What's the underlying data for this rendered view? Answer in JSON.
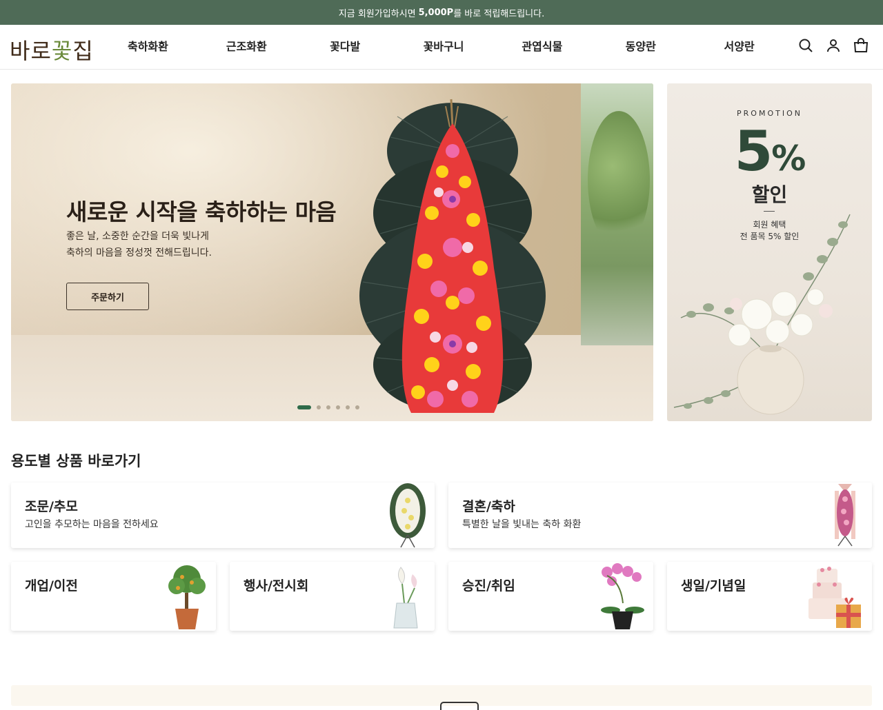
{
  "top_banner": {
    "text_prefix": "지금 회원가입하시면",
    "text_bold": "5,000P",
    "text_suffix": "를 바로 적립해드립니다."
  },
  "header": {
    "logo": {
      "part1": "바로",
      "part2": "꽃",
      "part3": "집"
    },
    "nav": [
      "축하화환",
      "근조화환",
      "꽃다발",
      "꽃바구니",
      "관엽식물",
      "동양란",
      "서양란"
    ],
    "icons": [
      "search-icon",
      "user-icon",
      "cart-icon"
    ]
  },
  "hero": {
    "title": "새로운 시작을 축하하는 마음",
    "sub_line1": "좋은 날, 소중한 순간을 더욱 빛나게",
    "sub_line2": "축하의 마음을 정성껏 전해드립니다.",
    "button_label": "주문하기",
    "slide_count": 6,
    "active_slide": 1
  },
  "promo": {
    "label": "PROMOTION",
    "big_number": "5",
    "percent": "%",
    "sale": "할인",
    "desc_line1": "회원 혜택",
    "desc_line2": "전 품목 5% 할인"
  },
  "section": {
    "title": "용도별 상품 바로가기",
    "cards": [
      {
        "title": "조문/추모",
        "desc": "고인을 추모하는 마음을 전하세요",
        "icon": "funeral-wreath-icon"
      },
      {
        "title": "결혼/축하",
        "desc": "특별한 날을 빛내는 축하 화환",
        "icon": "celebration-wreath-icon"
      },
      {
        "title": "개업/이전",
        "desc": "",
        "icon": "money-tree-icon"
      },
      {
        "title": "행사/전시회",
        "desc": "",
        "icon": "calla-lily-vase-icon"
      },
      {
        "title": "승진/취임",
        "desc": "",
        "icon": "orchid-pot-icon"
      },
      {
        "title": "생일/기념일",
        "desc": "",
        "icon": "cake-gift-icon"
      }
    ]
  },
  "colors": {
    "brand_green": "#4f6b57",
    "logo_brown": "#3f2a18",
    "promo_green": "#2f4a39"
  }
}
